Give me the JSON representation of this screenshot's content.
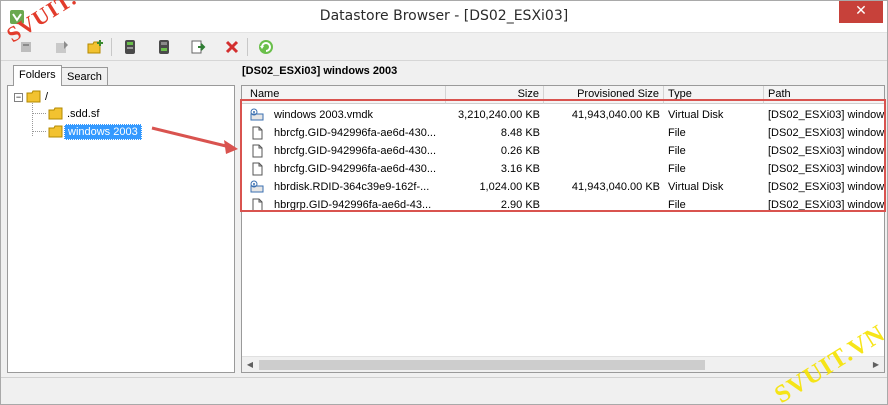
{
  "window": {
    "title": "Datastore Browser - [DS02_ESXi03]",
    "close_symbol": "✕"
  },
  "toolbar": {
    "buttons": [
      {
        "icon": "datastore-icon"
      },
      {
        "icon": "upload-icon"
      },
      {
        "icon": "new-folder-icon"
      },
      {
        "icon": "upload-file-icon"
      },
      {
        "icon": "download-file-icon"
      },
      {
        "icon": "move-icon"
      },
      {
        "icon": "delete-icon"
      },
      {
        "icon": "refresh-icon"
      }
    ]
  },
  "left_pane": {
    "tabs": [
      {
        "label": "Folders",
        "active": true
      },
      {
        "label": "Search",
        "active": false
      }
    ],
    "tree": {
      "root": {
        "label": "/",
        "expander": "−"
      },
      "children": [
        {
          "label": ".sdd.sf",
          "selected": false
        },
        {
          "label": "windows 2003",
          "selected": true
        }
      ]
    }
  },
  "right_pane": {
    "path_label": "[DS02_ESXi03] windows 2003",
    "columns": [
      "Name",
      "Size",
      "Provisioned Size",
      "Type",
      "Path"
    ],
    "rows": [
      {
        "icon": "virtual-disk-icon",
        "name": "windows 2003.vmdk",
        "size": "3,210,240.00 KB",
        "provisioned": "41,943,040.00 KB",
        "type": "Virtual Disk",
        "path": "[DS02_ESXi03] window"
      },
      {
        "icon": "file-icon",
        "name": "hbrcfg.GID-942996fa-ae6d-430...",
        "size": "8.48 KB",
        "provisioned": "",
        "type": "File",
        "path": "[DS02_ESXi03] window"
      },
      {
        "icon": "file-icon",
        "name": "hbrcfg.GID-942996fa-ae6d-430...",
        "size": "0.26 KB",
        "provisioned": "",
        "type": "File",
        "path": "[DS02_ESXi03] window"
      },
      {
        "icon": "file-icon",
        "name": "hbrcfg.GID-942996fa-ae6d-430...",
        "size": "3.16 KB",
        "provisioned": "",
        "type": "File",
        "path": "[DS02_ESXi03] window"
      },
      {
        "icon": "virtual-disk-icon",
        "name": "hbrdisk.RDID-364c39e9-162f-...",
        "size": "1,024.00 KB",
        "provisioned": "41,943,040.00 KB",
        "type": "Virtual Disk",
        "path": "[DS02_ESXi03] window"
      },
      {
        "icon": "file-icon",
        "name": "hbrgrp.GID-942996fa-ae6d-43...",
        "size": "2.90 KB",
        "provisioned": "",
        "type": "File",
        "path": "[DS02_ESXi03] window"
      }
    ]
  },
  "watermarks": {
    "top_left": "SVUIT.COM",
    "bottom_right": "SVUIT.VN"
  },
  "colors": {
    "annotation": "#d9534f",
    "selection": "#3399ff",
    "watermark_red": "#e23b2b",
    "watermark_yellow": "#f6e300"
  }
}
